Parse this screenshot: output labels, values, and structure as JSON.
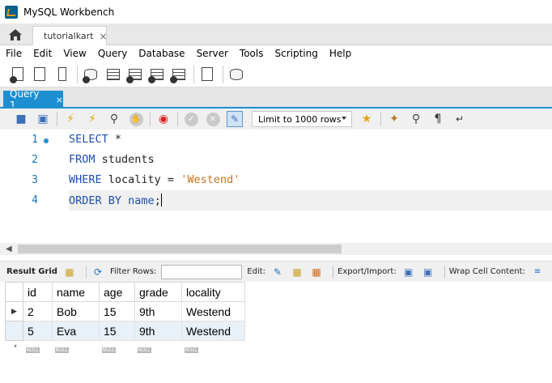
{
  "window": {
    "title": "MySQL Workbench"
  },
  "connection_tab": {
    "label": "tutorialkart",
    "close": "×"
  },
  "menu": [
    "File",
    "Edit",
    "View",
    "Query",
    "Database",
    "Server",
    "Tools",
    "Scripting",
    "Help"
  ],
  "query_tab": {
    "label": "Query 1",
    "close": "×"
  },
  "query_toolbar": {
    "limit_label": "Limit to 1000 rows"
  },
  "editor": {
    "line_numbers": [
      "1",
      "2",
      "3",
      "4"
    ],
    "lines": [
      {
        "kw": "SELECT",
        "rest": " *"
      },
      {
        "kw": "FROM",
        "rest": " students"
      },
      {
        "kw": "WHERE",
        "rest": " locality = ",
        "str": "'Westend'"
      },
      {
        "kw": "ORDER BY",
        "kw2": "name",
        "rest": ";"
      }
    ]
  },
  "result_toolbar": {
    "result_grid_label": "Result Grid",
    "filter_label": "Filter Rows:",
    "edit_label": "Edit:",
    "export_label": "Export/Import:",
    "wrap_label": "Wrap Cell Content:"
  },
  "result": {
    "columns": [
      "id",
      "name",
      "age",
      "grade",
      "locality"
    ],
    "rows": [
      [
        "2",
        "Bob",
        "15",
        "9th",
        "Westend"
      ],
      [
        "5",
        "Eva",
        "15",
        "9th",
        "Westend"
      ]
    ],
    "current_row_marker": "▶",
    "new_row_marker": "*",
    "null_label": "NULL"
  },
  "colors": {
    "accent": "#1d8fd1",
    "keyword": "#1f4fb0",
    "string": "#c8741a"
  }
}
